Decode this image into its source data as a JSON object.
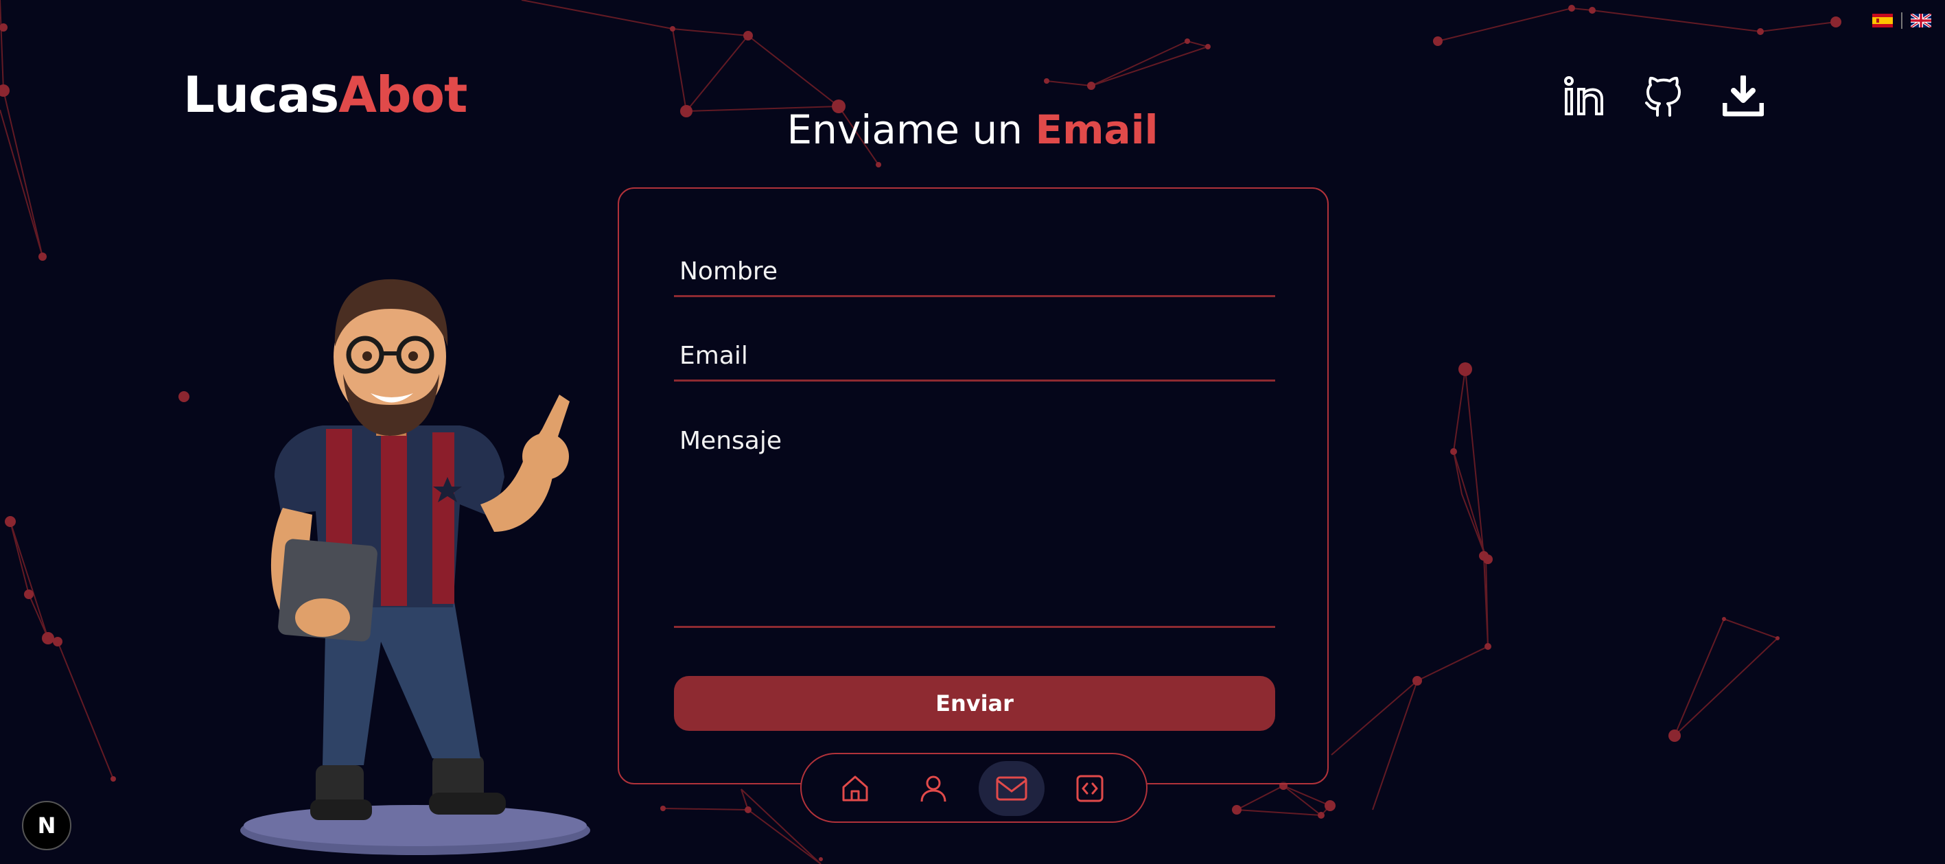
{
  "header": {
    "logo_first": "Lucas",
    "logo_second": "Abot",
    "languages": [
      {
        "code": "es",
        "icon": "spain-flag-icon"
      },
      {
        "code": "en",
        "icon": "uk-flag-icon"
      }
    ],
    "social_icons": [
      "linkedin-icon",
      "github-icon",
      "download-icon"
    ]
  },
  "contact": {
    "title_prefix": "Enviame un",
    "title_accent": "Email",
    "name_placeholder": "Nombre",
    "email_placeholder": "Email",
    "message_placeholder": "Mensaje",
    "submit_label": "Enviar"
  },
  "dock": {
    "items": [
      {
        "icon": "home-icon",
        "active": false
      },
      {
        "icon": "user-icon",
        "active": false
      },
      {
        "icon": "mail-icon",
        "active": true
      },
      {
        "icon": "code-icon",
        "active": false
      }
    ]
  },
  "badge": {
    "label": "N"
  },
  "colors": {
    "background": "#05061a",
    "accent": "#e14a4a",
    "accent_dark": "#8e2a31",
    "border": "#b1323a",
    "text": "#ffffff"
  }
}
